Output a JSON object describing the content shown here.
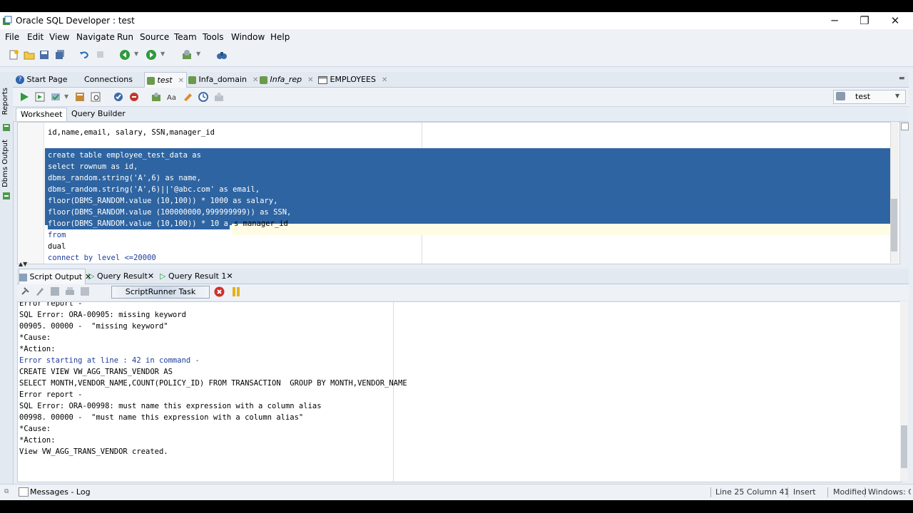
{
  "window": {
    "title": "Oracle SQL Developer : test",
    "minimize": "─",
    "restore": "❐",
    "close": "✕"
  },
  "menu": [
    "File",
    "Edit",
    "View",
    "Navigate",
    "Run",
    "Source",
    "Team",
    "Tools",
    "Window",
    "Help"
  ],
  "side_tabs": [
    "Reports",
    "Dbms Output"
  ],
  "editor_tabs": [
    {
      "label": "Start Page",
      "icon": "help-icon"
    },
    {
      "label": "Connections",
      "icon": ""
    },
    {
      "label": "test",
      "icon": "sql-worksheet-icon",
      "active": true
    },
    {
      "label": "Infa_domain",
      "icon": "sql-worksheet-icon"
    },
    {
      "label": "Infa_rep",
      "icon": "sql-worksheet-icon"
    },
    {
      "label": "EMPLOYEES",
      "icon": "table-icon"
    }
  ],
  "connection": {
    "selected": "test"
  },
  "sub_tabs": [
    "Worksheet",
    "Query Builder"
  ],
  "code": [
    "id,name,email, salary, SSN,manager_id",
    "",
    "create table employee_test_data as",
    "select rownum as id,",
    "dbms_random.string('A',6) as name,",
    "dbms_random.string('A',6)||'@abc.com' as email,",
    "floor(DBMS_RANDOM.value (10,100)) * 1000 as salary,",
    "floor(DBMS_RANDOM.value (100000000,999999999)) as SSN,",
    "floor(DBMS_RANDOM.value (10,100)) * 10 a",
    "s manager_id",
    "from",
    "dual",
    "connect by level <=20000"
  ],
  "output_tabs": [
    {
      "label": "Script Output",
      "active": true
    },
    {
      "label": "Query Result"
    },
    {
      "label": "Query Result 1"
    }
  ],
  "task": {
    "label": "ScriptRunner Task"
  },
  "output_lines": [
    {
      "text": "Error report -",
      "blue": false
    },
    {
      "text": "SQL Error: ORA-00905: missing keyword",
      "blue": false
    },
    {
      "text": "00905. 00000 -  \"missing keyword\"",
      "blue": false
    },
    {
      "text": "*Cause:",
      "blue": false
    },
    {
      "text": "*Action:",
      "blue": false
    },
    {
      "text": "Error starting at line : 42 in command -",
      "blue": true
    },
    {
      "text": "CREATE VIEW VW_AGG_TRANS_VENDOR AS",
      "blue": false
    },
    {
      "text": "SELECT MONTH,VENDOR_NAME,COUNT(POLICY_ID) FROM TRANSACTION  GROUP BY MONTH,VENDOR_NAME",
      "blue": false
    },
    {
      "text": "Error report -",
      "blue": false
    },
    {
      "text": "SQL Error: ORA-00998: must name this expression with a column alias",
      "blue": false
    },
    {
      "text": "00998. 00000 -  \"must name this expression with a column alias\"",
      "blue": false
    },
    {
      "text": "*Cause:",
      "blue": false
    },
    {
      "text": "*Action:",
      "blue": false
    },
    {
      "text": "View VW_AGG_TRANS_VENDOR created.",
      "blue": false
    }
  ],
  "status": {
    "messages_tab": "Messages - Log",
    "position": "Line 25 Column 41",
    "mode": "Insert",
    "modified": "Modified",
    "line_endings": "Windows: CR"
  }
}
